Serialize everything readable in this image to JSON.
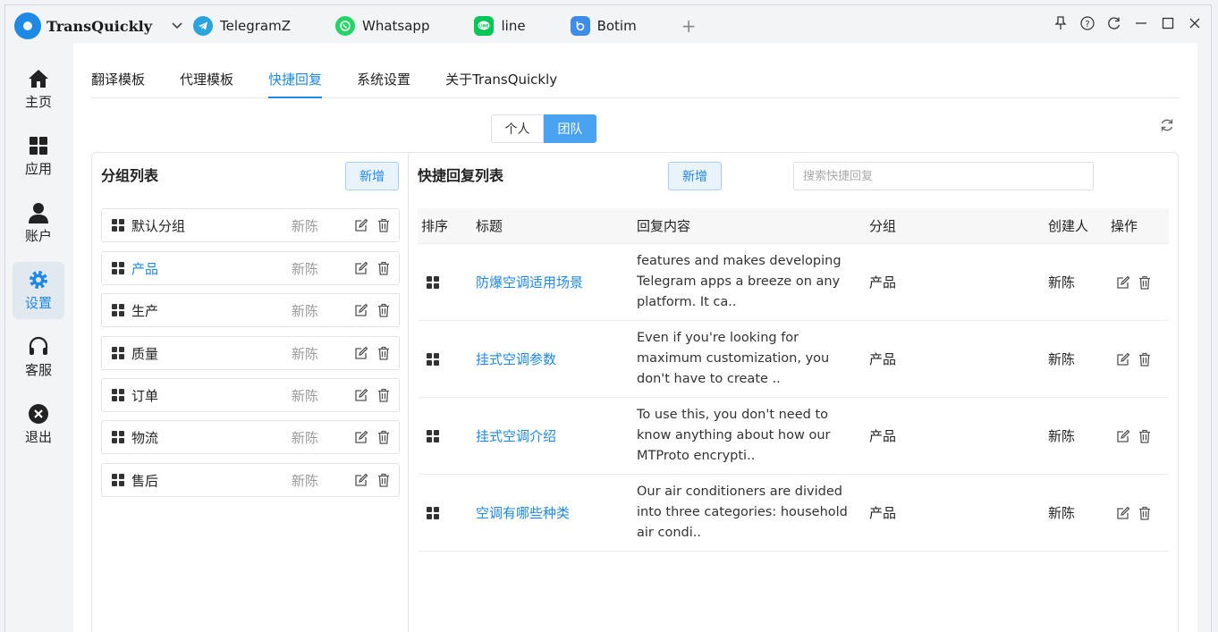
{
  "app": {
    "name": "TransQuickly",
    "tabs": [
      {
        "label": "TelegramZ",
        "icon": "telegram-icon"
      },
      {
        "label": "Whatsapp",
        "icon": "whatsapp-icon"
      },
      {
        "label": "line",
        "icon": "line-icon"
      },
      {
        "label": "Botim",
        "icon": "botim-icon"
      }
    ],
    "window_controls": [
      "pin-icon",
      "help-icon",
      "refresh-icon",
      "minimize-icon",
      "maximize-icon",
      "close-icon"
    ]
  },
  "sidebar": {
    "items": [
      {
        "label": "主页",
        "icon": "home-icon"
      },
      {
        "label": "应用",
        "icon": "apps-icon"
      },
      {
        "label": "账户",
        "icon": "user-icon"
      },
      {
        "label": "设置",
        "icon": "gear-icon",
        "active": true
      },
      {
        "label": "客服",
        "icon": "headset-icon"
      },
      {
        "label": "退出",
        "icon": "exit-icon"
      }
    ]
  },
  "top_tabs": [
    "翻译模板",
    "代理模板",
    "快捷回复",
    "系统设置",
    "关于TransQuickly"
  ],
  "active_top_tab": "快捷回复",
  "scope_toggle": {
    "personal": "个人",
    "team": "团队",
    "selected": "团队"
  },
  "groups_panel": {
    "title": "分组列表",
    "add_label": "新增",
    "items": [
      {
        "name": "默认分组",
        "owner": "新陈"
      },
      {
        "name": "产品",
        "owner": "新陈",
        "active": true
      },
      {
        "name": "生产",
        "owner": "新陈"
      },
      {
        "name": "质量",
        "owner": "新陈"
      },
      {
        "name": "订单",
        "owner": "新陈"
      },
      {
        "name": "物流",
        "owner": "新陈"
      },
      {
        "name": "售后",
        "owner": "新陈"
      }
    ]
  },
  "replies_panel": {
    "title": "快捷回复列表",
    "add_label": "新增",
    "search_placeholder": "搜索快捷回复",
    "columns": {
      "order": "排序",
      "title": "标题",
      "content": "回复内容",
      "group": "分组",
      "creator": "创建人",
      "ops": "操作"
    },
    "rows": [
      {
        "title": "防爆空调适用场景",
        "content": "features and makes developing Telegram apps a breeze on any platform. It ca..",
        "group": "产品",
        "creator": "新陈"
      },
      {
        "title": "挂式空调参数",
        "content": "Even if you're looking for maximum customization, you don't have to create ..",
        "group": "产品",
        "creator": "新陈"
      },
      {
        "title": "挂式空调介绍",
        "content": "To use this, you don't need to know anything about how our MTProto encrypti..",
        "group": "产品",
        "creator": "新陈"
      },
      {
        "title": "空调有哪些种类",
        "content": "Our air conditioners are divided into three categories: household air condi..",
        "group": "产品",
        "creator": "新陈"
      }
    ]
  },
  "colors": {
    "accent": "#1e88e5",
    "toggle_active": "#4aa3f0"
  }
}
